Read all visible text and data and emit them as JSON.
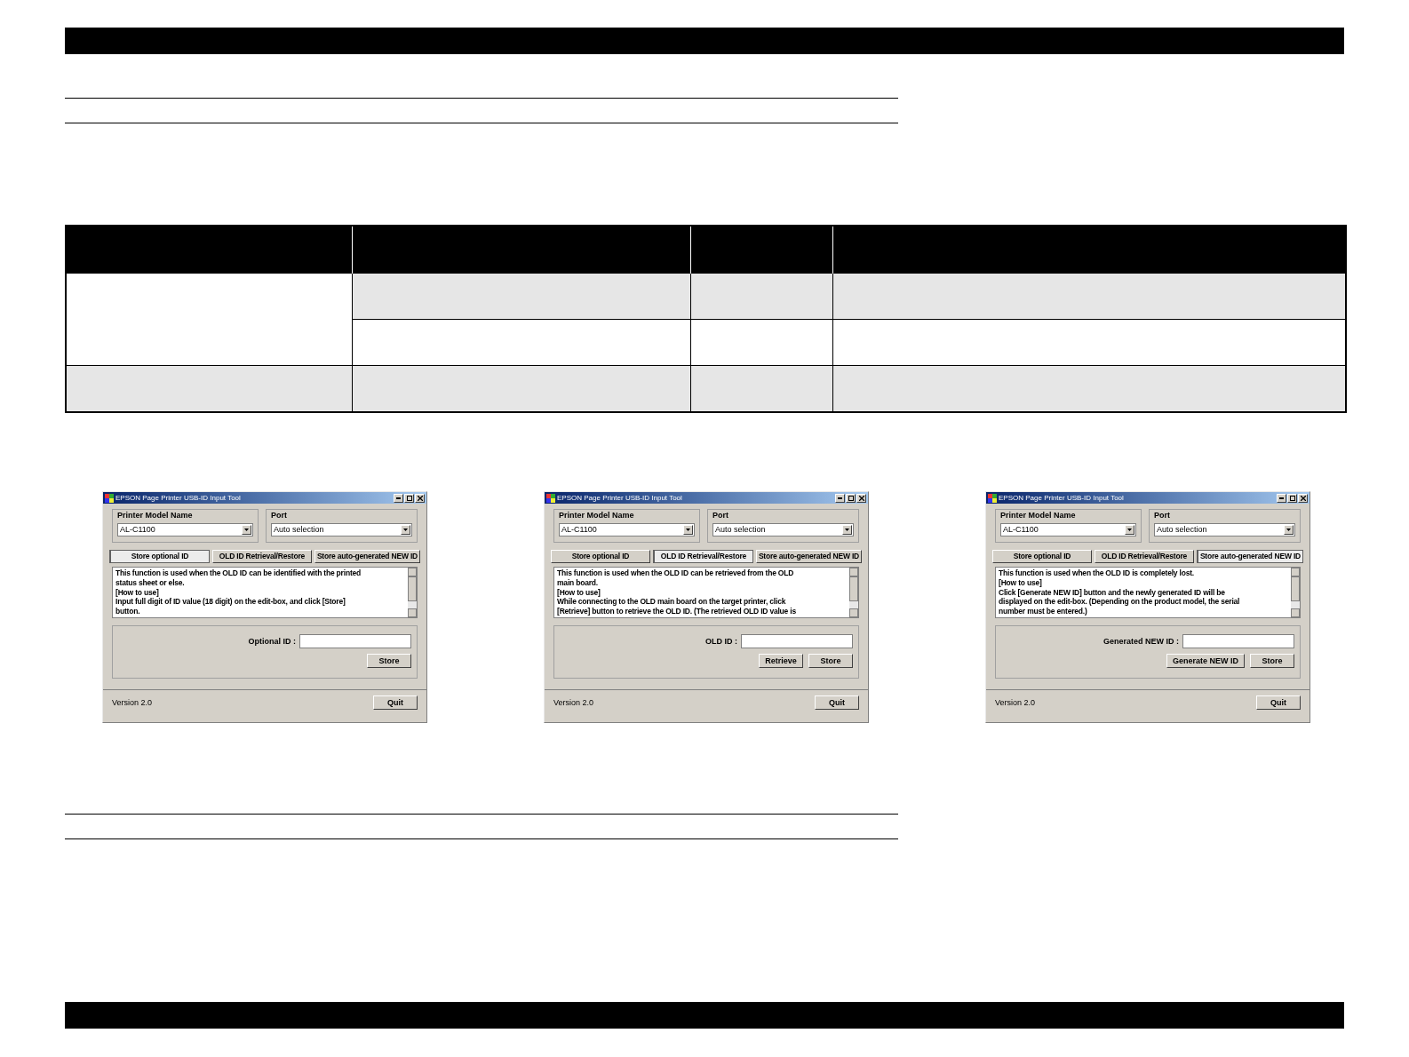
{
  "dialogs": [
    {
      "title": "EPSON Page Printer USB-ID Input Tool",
      "model_label": "Printer Model Name",
      "model_value": "AL-C1100",
      "port_label": "Port",
      "port_value": "Auto selection",
      "tabs": [
        {
          "label": "Store optional ID",
          "selected": true
        },
        {
          "label": "OLD ID Retrieval/Restore",
          "selected": false
        },
        {
          "label": "Store auto-generated NEW ID",
          "selected": false
        }
      ],
      "description": "This function is used when the OLD ID can be identified with the printed\nstatus sheet or else.\n[How to use]\nInput full digit of ID value (18 digit) on the edit-box, and click [Store]\nbutton.",
      "field_label": "Optional ID :",
      "buttons": [
        "Store"
      ],
      "version": "Version 2.0",
      "quit": "Quit"
    },
    {
      "title": "EPSON Page Printer USB-ID Input Tool",
      "model_label": "Printer Model Name",
      "model_value": "AL-C1100",
      "port_label": "Port",
      "port_value": "Auto selection",
      "tabs": [
        {
          "label": "Store optional ID",
          "selected": false
        },
        {
          "label": "OLD ID Retrieval/Restore",
          "selected": true
        },
        {
          "label": "Store auto-generated NEW ID",
          "selected": false
        }
      ],
      "description": "This function is used when the OLD ID can be retrieved from the OLD\nmain board.\n[How to use]\nWhile connecting to the OLD main board on the target printer, click\n[Retrieve] button to retrieve the OLD ID. (The retrieved OLD ID value is",
      "field_label": "OLD ID :",
      "buttons": [
        "Retrieve",
        "Store"
      ],
      "version": "Version 2.0",
      "quit": "Quit"
    },
    {
      "title": "EPSON Page Printer USB-ID Input Tool",
      "model_label": "Printer Model Name",
      "model_value": "AL-C1100",
      "port_label": "Port",
      "port_value": "Auto selection",
      "tabs": [
        {
          "label": "Store optional ID",
          "selected": false
        },
        {
          "label": "OLD ID Retrieval/Restore",
          "selected": false
        },
        {
          "label": "Store auto-generated NEW ID",
          "selected": true
        }
      ],
      "description": "This function is used when the OLD ID is completely lost.\n[How to use]\nClick [Generate NEW ID] button and the newly generated ID will be\ndisplayed on the edit-box. (Depending on the product model, the serial\nnumber must be entered.)",
      "field_label": "Generated NEW ID :",
      "buttons": [
        "Generate NEW ID",
        "Store"
      ],
      "version": "Version 2.0",
      "quit": "Quit"
    }
  ]
}
